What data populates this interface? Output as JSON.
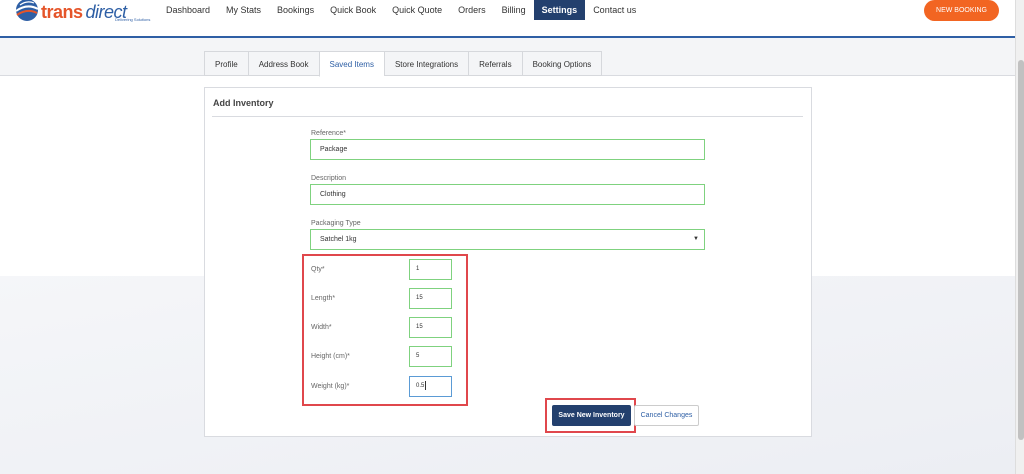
{
  "brand": {
    "name_part1": "trans",
    "name_part2": "direct",
    "tagline": "Delivering Solutions"
  },
  "nav": {
    "items": [
      {
        "label": "Dashboard",
        "active": false
      },
      {
        "label": "My Stats",
        "active": false
      },
      {
        "label": "Bookings",
        "active": false
      },
      {
        "label": "Quick Book",
        "active": false
      },
      {
        "label": "Quick Quote",
        "active": false
      },
      {
        "label": "Orders",
        "active": false
      },
      {
        "label": "Billing",
        "active": false
      },
      {
        "label": "Settings",
        "active": true
      },
      {
        "label": "Contact us",
        "active": false
      }
    ],
    "new_booking_label": "NEW BOOKING"
  },
  "tabs": [
    {
      "label": "Profile",
      "active": false
    },
    {
      "label": "Address Book",
      "active": false
    },
    {
      "label": "Saved Items",
      "active": true
    },
    {
      "label": "Store Integrations",
      "active": false
    },
    {
      "label": "Referrals",
      "active": false
    },
    {
      "label": "Booking Options",
      "active": false
    }
  ],
  "form": {
    "title": "Add Inventory",
    "reference": {
      "label": "Reference*",
      "value": "Package"
    },
    "description": {
      "label": "Description",
      "value": "Clothing"
    },
    "packaging_type": {
      "label": "Packaging Type",
      "value": "Satchel 1kg"
    },
    "qty": {
      "label": "Qty*",
      "value": "1"
    },
    "length": {
      "label": "Length*",
      "value": "15"
    },
    "width": {
      "label": "Width*",
      "value": "15"
    },
    "height": {
      "label": "Height (cm)*",
      "value": "5"
    },
    "weight": {
      "label": "Weight (kg)*",
      "value": "0.5"
    },
    "save_label": "Save New Inventory",
    "cancel_label": "Cancel Changes"
  },
  "colors": {
    "brand_orange": "#f26522",
    "brand_navy": "#23406e",
    "valid_green": "#7fd27f",
    "highlight_red": "#e0474c"
  }
}
